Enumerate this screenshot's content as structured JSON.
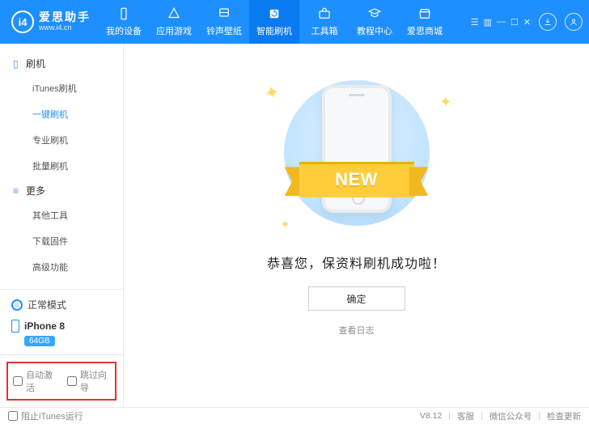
{
  "header": {
    "app_name": "爱思助手",
    "app_url": "www.i4.cn",
    "nav": [
      {
        "label": "我的设备"
      },
      {
        "label": "应用游戏"
      },
      {
        "label": "铃声壁纸"
      },
      {
        "label": "智能刷机",
        "active": true
      },
      {
        "label": "工具箱"
      },
      {
        "label": "教程中心"
      },
      {
        "label": "爱思商城"
      }
    ]
  },
  "sidebar": {
    "group1": {
      "title": "刷机",
      "items": [
        "iTunes刷机",
        "一键刷机",
        "专业刷机",
        "批量刷机"
      ],
      "active_index": 1
    },
    "group2": {
      "title": "更多",
      "items": [
        "其他工具",
        "下载固件",
        "高级功能"
      ]
    },
    "mode": "正常模式",
    "device": {
      "name": "iPhone 8",
      "storage": "64GB"
    },
    "auto_activate_label": "自动激活",
    "skip_guide_label": "跳过向导"
  },
  "main": {
    "ribbon_text": "NEW",
    "message": "恭喜您，保资料刷机成功啦！",
    "ok_label": "确定",
    "log_link": "查看日志"
  },
  "footer": {
    "block_itunes_label": "阻止iTunes运行",
    "version": "V8.12",
    "support": "客服",
    "wechat": "微信公众号",
    "update": "检查更新"
  }
}
